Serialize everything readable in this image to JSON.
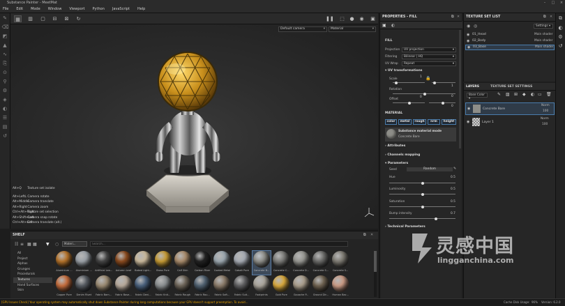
{
  "window": {
    "title": "Substance Painter - MeetMat"
  },
  "menu": [
    "File",
    "Edit",
    "Mode",
    "Window",
    "Viewport",
    "Python",
    "JavaScript",
    "Help"
  ],
  "viewport": {
    "camera_select": "Default camera",
    "channel_select": "Material",
    "hotkeys": [
      {
        "key": "Alt+Q",
        "action": "Texture set isolate"
      },
      {
        "key": "Alt+LeftL",
        "action": "Camera rotate"
      },
      {
        "key": "Alt+Middle",
        "action": "Camera translate"
      },
      {
        "key": "Alt+Right",
        "action": "Camera zoom"
      },
      {
        "key": "Ctrl+Alt+Right",
        "action": "Texture set selection"
      },
      {
        "key": "Alt+Shift+Left",
        "action": "Camera snap rotate"
      },
      {
        "key": "Ctrl+Alt+Left",
        "action": "Camera translate (alt.)"
      }
    ]
  },
  "shelf": {
    "title": "SHELF",
    "filter_tag": "Materi...",
    "search_placeholder": "Search...",
    "categories": [
      "All",
      "Project",
      "Alphas",
      "Grunges",
      "Procedurals",
      "Textures",
      "Hand Surfaces",
      "Skin"
    ],
    "active_category": "Textures",
    "materials_row1": [
      {
        "name": "Aluminium ...",
        "color": "#b5732a"
      },
      {
        "name": "Aluminium ...",
        "color": "#9aa0a6"
      },
      {
        "name": "Artificial Lea...",
        "color": "#444444"
      },
      {
        "name": "Autumn Leaf",
        "color": "#8a4a1e"
      },
      {
        "name": "Baked Light...",
        "color": "#c9b89a"
      },
      {
        "name": "Brass Pure",
        "color": "#c59a34"
      },
      {
        "name": "Calf Skin",
        "color": "#a88a6a"
      },
      {
        "name": "Carbon Fiber",
        "color": "#222222"
      },
      {
        "name": "Coated Metal",
        "color": "#9aa6ae"
      },
      {
        "name": "Cobalt Pure",
        "color": "#a5aab2"
      },
      {
        "name": "Concrete B...",
        "color": "#8d8d88"
      },
      {
        "name": "Concrete C...",
        "color": "#7b7b78"
      },
      {
        "name": "Concrete D...",
        "color": "#959590"
      },
      {
        "name": "Concrete S...",
        "color": "#6a6a68"
      },
      {
        "name": "Concrete S...",
        "color": "#7d7a72"
      }
    ],
    "materials_row2": [
      {
        "name": "Copper Pure",
        "color": "#c46c3c"
      },
      {
        "name": "Denim Rivet",
        "color": "#555a60"
      },
      {
        "name": "Fabric Barn...",
        "color": "#9a8a72"
      },
      {
        "name": "Fabric Base...",
        "color": "#b7a99a"
      },
      {
        "name": "Fabric Deni...",
        "color": "#49607c"
      },
      {
        "name": "Fabric Knit...",
        "color": "#8a8e90"
      },
      {
        "name": "Fabric Rough",
        "color": "#6d6458"
      },
      {
        "name": "Fabric Rou...",
        "color": "#4f6070"
      },
      {
        "name": "Fabric Soft...",
        "color": "#8a7a68"
      },
      {
        "name": "Fabric Suit...",
        "color": "#5e5e60"
      },
      {
        "name": "Footprints",
        "color": "#a9a49a"
      },
      {
        "name": "Gold Pure",
        "color": "#d8a83c"
      },
      {
        "name": "Gouache P...",
        "color": "#a89c8a"
      },
      {
        "name": "Ground Dir...",
        "color": "#6f6250"
      },
      {
        "name": "Human Bac...",
        "color": "#c99a84"
      }
    ]
  },
  "status": {
    "message": "[GPU Issues Check] Your operating system may automatically shut down Substance Painter during long computations because your GPU doesn't support preemption. To avoid...",
    "cache": "Cache Disk Usage:",
    "percent": "96%",
    "version": "Version: 6.2.0"
  },
  "properties": {
    "title": "PROPERTIES - FILL",
    "fill_label": "FILL",
    "projection_label": "Projection",
    "projection_value": "UV projection",
    "filtering_label": "Filtering",
    "filtering_value": "Bilinear | HQ",
    "uvwrap_label": "UV Wrap",
    "uvwrap_value": "Repeat",
    "uv_transform_label": "UV transformations",
    "scale_label": "Scale",
    "scale_value": "1",
    "scale_value2": "1",
    "rotation_label": "Rotation",
    "rotation_value": "0",
    "offset_label": "Offset",
    "offset_value": "0",
    "offset_value2": "0",
    "material_label": "MATERIAL",
    "channels": [
      "color",
      "metal",
      "rough",
      "nrm",
      "height"
    ],
    "material_mode_title": "Substance material mode",
    "material_mode_value": "Concrete Bare",
    "attributes_label": "Attributes",
    "channels_mapping_label": "Channels mapping",
    "parameters_label": "Parameters",
    "seed_label": "Seed",
    "seed_button": "Random",
    "hue_label": "Hue",
    "hue_value": "0.5",
    "luminosity_label": "Luminosity",
    "luminosity_value": "0.5",
    "saturation_label": "Saturation",
    "saturation_value": "0.5",
    "bump_label": "Bump intensity",
    "bump_value": "0.7",
    "technical_label": "Technical Parameters"
  },
  "texture_set_list": {
    "title": "TEXTURE SET LIST",
    "settings_label": "Settings",
    "items": [
      {
        "name": "01_Head",
        "shader": "Main shader"
      },
      {
        "name": "02_Body",
        "shader": "Main shader"
      },
      {
        "name": "03_Base",
        "shader": "Main shader"
      }
    ]
  },
  "layers": {
    "tab_layers": "LAYERS",
    "tab_settings": "TEXTURE SET SETTINGS",
    "channel_select": "Base Color",
    "items": [
      {
        "name": "Concrete Bare",
        "blend": "Norm",
        "opacity": "100"
      },
      {
        "name": "Layer 1",
        "blend": "Norm",
        "opacity": "100"
      }
    ]
  },
  "watermark": {
    "cn": "灵感中国",
    "url": "lingganchina.com"
  }
}
